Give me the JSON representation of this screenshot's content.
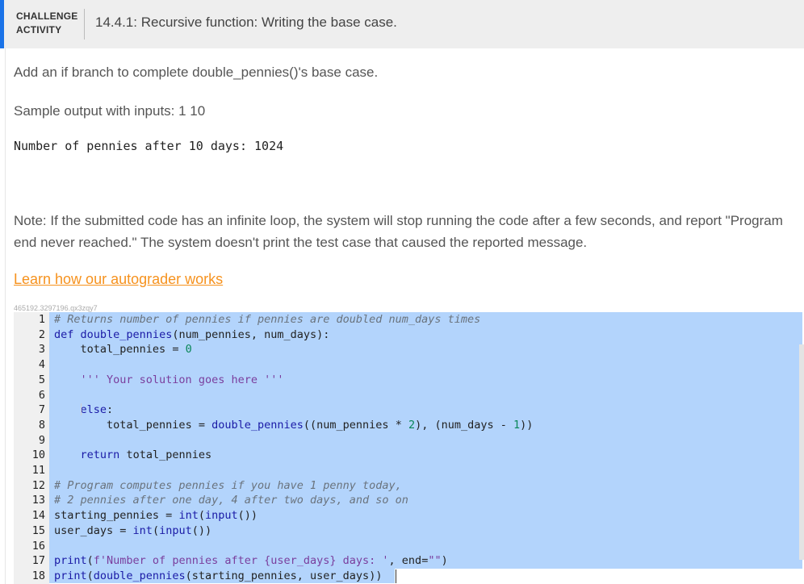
{
  "header": {
    "label": "CHALLENGE ACTIVITY",
    "title": "14.4.1: Recursive function: Writing the base case."
  },
  "content": {
    "instructions": "Add an if branch to complete double_pennies()'s base case.",
    "sample_label": "Sample output with inputs: 1 10",
    "sample_output": "Number of pennies after 10 days: 1024",
    "note": "Note: If the submitted code has an infinite loop, the system will stop running the code after a few seconds, and report \"Program end never reached.\" The system doesn't print the test case that caused the reported message.",
    "learn_link": "Learn how our autograder works",
    "code_id": "465192.3297196.qx3zqy7"
  },
  "editor": {
    "lines": [
      {
        "n": "1",
        "text": "# Returns number of pennies if pennies are doubled num_days times"
      },
      {
        "n": "2",
        "text": "def double_pennies(num_pennies, num_days):"
      },
      {
        "n": "3",
        "text": "    total_pennies = 0"
      },
      {
        "n": "4",
        "text": ""
      },
      {
        "n": "5",
        "text": "    ''' Your solution goes here '''"
      },
      {
        "n": "6",
        "text": ""
      },
      {
        "n": "7",
        "text": "    else:"
      },
      {
        "n": "8",
        "text": "        total_pennies = double_pennies((num_pennies * 2), (num_days - 1))"
      },
      {
        "n": "9",
        "text": ""
      },
      {
        "n": "10",
        "text": "    return total_pennies"
      },
      {
        "n": "11",
        "text": ""
      },
      {
        "n": "12",
        "text": "# Program computes pennies if you have 1 penny today,"
      },
      {
        "n": "13",
        "text": "# 2 pennies after one day, 4 after two days, and so on"
      },
      {
        "n": "14",
        "text": "starting_pennies = int(input())"
      },
      {
        "n": "15",
        "text": "user_days = int(input())"
      },
      {
        "n": "16",
        "text": ""
      },
      {
        "n": "17",
        "text": "print(f'Number of pennies after {user_days} days: ', end=\"\")"
      },
      {
        "n": "18",
        "text": "print(double_pennies(starting_pennies, user_days))"
      }
    ]
  },
  "colors": {
    "accent": "#1a73e8",
    "link": "#f6921e",
    "selection": "#b3d4fc"
  }
}
